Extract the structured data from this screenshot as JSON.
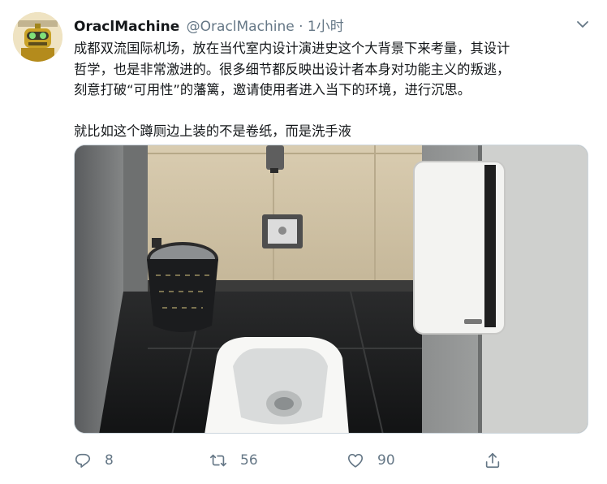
{
  "tweet": {
    "display_name": "OraclMachine",
    "handle": "@OraclMachine",
    "separator": "·",
    "time": "1小时",
    "text_lines": [
      "成都双流国际机场，放在当代室内设计演进史这个大背景下来考量，其设计",
      "哲学，也是非常激进的。很多细节都反映出设计者本身对功能主义的叛逃，",
      "刻意打破“可用性”的藩篱，邀请使用者进入当下的环境，进行沉思。"
    ],
    "text_line_2": "就比如这个蹲厕边上装的不是卷纸，而是洗手液",
    "media_icon": "photo",
    "actions": {
      "reply_count": "8",
      "retweet_count": "56",
      "like_count": "90"
    },
    "icons": {
      "reply": "reply-icon",
      "retweet": "retweet-icon",
      "like": "heart-icon",
      "share": "share-icon",
      "menu": "chevron-down-icon"
    },
    "colors": {
      "text": "#14171a",
      "secondary": "#657786",
      "border": "#ccd6dd"
    }
  }
}
